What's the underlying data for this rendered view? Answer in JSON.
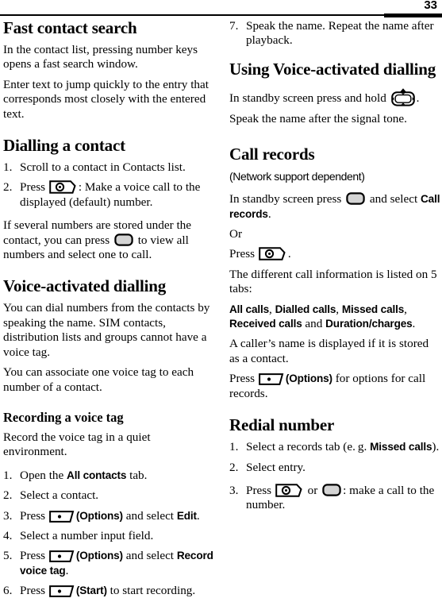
{
  "page": {
    "folio": "33",
    "rule": {
      "color": "#000000"
    }
  },
  "left_column": {
    "section1": {
      "heading": "Fast contact search",
      "p1": "In the contact list, pressing number keys opens a fast search window.",
      "p2": "Enter text to jump quickly to the entry that corresponds most closely with the entered text."
    },
    "section2": {
      "heading": "Dialling a contact",
      "steps": [
        {
          "num": "1.",
          "pre": "Scroll to a contact in Contacts list.",
          "icon": "",
          "post": ""
        },
        {
          "num": "2.",
          "pre": "Press ",
          "icon": "call-key-icon",
          "post": ": Make a voice call to the displayed (default) number."
        }
      ],
      "p1_a": "If several numbers are stored under the contact, you can press ",
      "p1_icon": "select-key-icon",
      "p1_b": " to view all numbers and select one to call."
    },
    "section3": {
      "heading": "Voice-activated dialling",
      "p1": "You can dial numbers from the contacts by speaking the name. SIM contacts, distribution lists and groups cannot have a voice tag.",
      "p2": "You can associate one voice tag to each number of a contact."
    },
    "section4": {
      "heading": "Recording a voice tag",
      "p1": "Record the voice tag in a quiet environment.",
      "steps": [
        {
          "num": "1.",
          "a": "Open the ",
          "ui1": "All contacts",
          "b": " tab."
        },
        {
          "num": "2.",
          "a": "Select a contact.",
          "ui1": "",
          "b": ""
        },
        {
          "num": "3.",
          "a": "Press ",
          "icon": "soft-key-icon",
          "paren": "(Options)",
          "b": " and select ",
          "ui1": "Edit",
          "c": "."
        },
        {
          "num": "4.",
          "a": "Select a number input field.",
          "ui1": "",
          "b": ""
        },
        {
          "num": "5.",
          "a": "Press ",
          "icon": "soft-key-icon",
          "paren": "(Options)",
          "b": " and select ",
          "ui1": "Record voice tag",
          "c": "."
        },
        {
          "num": "6.",
          "a": "Press ",
          "icon": "soft-key-icon",
          "paren": "(Start)",
          "b": " to start recording.",
          "ui1": "",
          "c": ""
        }
      ]
    }
  },
  "right_column": {
    "step7": {
      "num": "7.",
      "text": "Speak the name. Repeat the name after playback."
    },
    "section5": {
      "heading": "Using Voice-activated dialling",
      "p1_a": "In standby screen press and hold ",
      "p1_icon": "nav-key-up-icon",
      "p1_b": ".",
      "p2": "Speak the name after the signal tone."
    },
    "section6": {
      "heading": "Call records",
      "note": "(Network support dependent)",
      "p1_a": "In standby screen press ",
      "p1_icon": "select-key-icon",
      "p1_b": " and select ",
      "p1_ui": "Call records",
      "p1_c": ".",
      "p2": "Or",
      "p3_a": "Press ",
      "p3_icon": "call-key-icon",
      "p3_b": ".",
      "p4": "The different call information is listed on 5 tabs:",
      "tabs": [
        "All calls",
        "Dialled calls",
        "Missed calls",
        "Received calls",
        "Duration/charges"
      ],
      "tabs_joiner": " and ",
      "tabs_sep": ", ",
      "tabs_end": ".",
      "p5": "A caller’s name is displayed if it is stored as a contact.",
      "p6_a": "Press ",
      "p6_icon": "soft-key-icon",
      "p6_paren": "(Options)",
      "p6_b": " for options for call records."
    },
    "section7": {
      "heading": "Redial number",
      "steps": [
        {
          "num": "1.",
          "a": "Select a records tab (e. g. ",
          "ui1": "Missed calls",
          "b": ")."
        },
        {
          "num": "2.",
          "a": "Select entry.",
          "ui1": "",
          "b": ""
        },
        {
          "num": "3.",
          "a": "Press ",
          "icon1": "call-key-icon",
          "mid": " or ",
          "icon2": "select-key-icon",
          "b": ": make a call to the number."
        }
      ]
    }
  }
}
